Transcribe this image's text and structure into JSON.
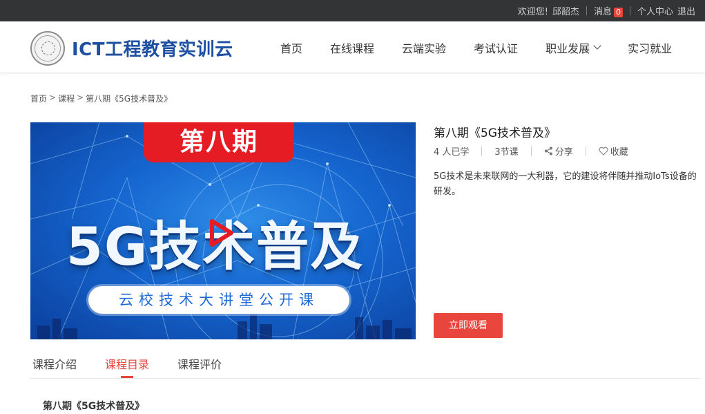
{
  "topbar": {
    "welcome": "欢迎您!",
    "username": "邱韶杰",
    "messages_label": "消息",
    "messages_count": "0",
    "profile": "个人中心",
    "logout": "退出"
  },
  "header": {
    "brand": "ICT工程教育实训云",
    "nav": [
      "首页",
      "在线课程",
      "云端实验",
      "考试认证",
      "职业发展",
      "实习就业"
    ]
  },
  "breadcrumb": {
    "home": "首页",
    "courses": "课程",
    "current": "第八期《5G技术普及》"
  },
  "banner": {
    "tag": "第八期",
    "headline": "5G技术普及",
    "subtitle": "云校技术大讲堂公开课"
  },
  "course": {
    "title": "第八期《5G技术普及》",
    "learners": "4 人已学",
    "lessons": "3节课",
    "share": "分享",
    "favorite": "收藏",
    "description": "5G技术是未来联网的一大利器，它的建设将伴随并推动IoTs设备的研发。",
    "watch_button": "立即观看"
  },
  "tabs": [
    "课程介绍",
    "课程目录",
    "课程评价"
  ],
  "active_tab": "课程目录",
  "catalog": {
    "section_title": "第八期《5G技术普及》"
  },
  "colors": {
    "accent": "#e8453c",
    "brand_blue": "#1d4fa3",
    "topbar_bg": "#333436"
  }
}
